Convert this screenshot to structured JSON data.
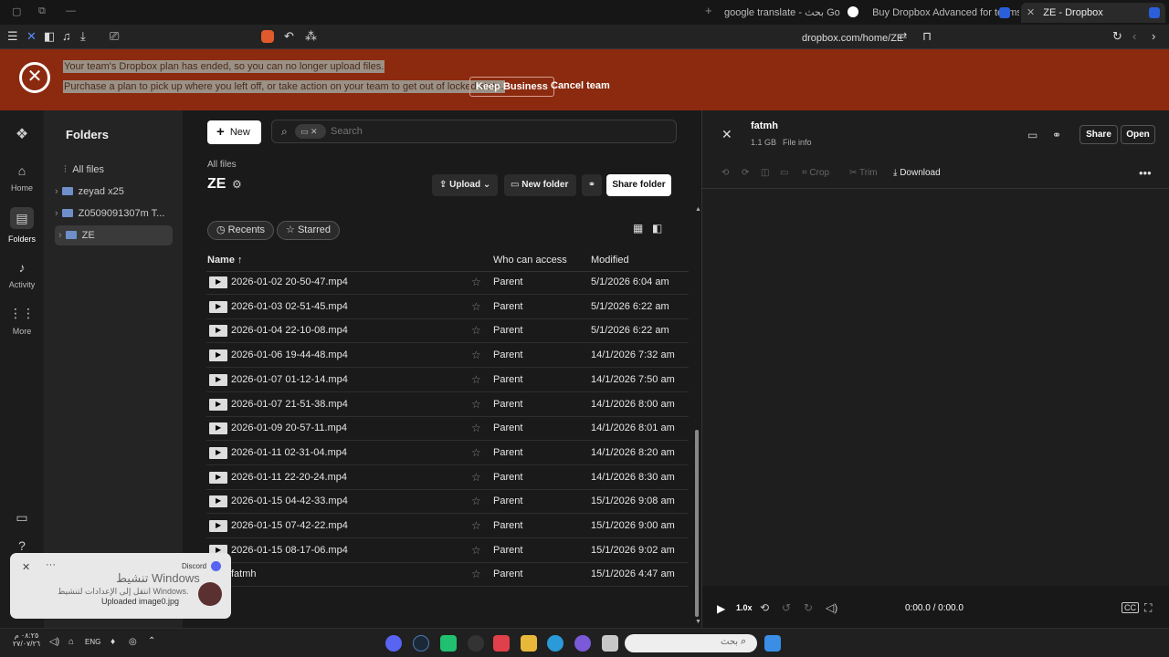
{
  "browser": {
    "tabs": [
      {
        "label": "google translate - بحث Google"
      },
      {
        "label": "Buy Dropbox Advanced for teams – D"
      },
      {
        "label": "ZE - Dropbox"
      }
    ],
    "address": "dropbox.com/home/ZE"
  },
  "banner": {
    "line1": "Your team's Dropbox plan has ended, so you can no longer upload files.",
    "line2": "Purchase a plan to pick up where you left off, or take action on your team to get out of locked state.",
    "keep_label": "Keep Business",
    "cancel_label": "Cancel team"
  },
  "rail": {
    "items": [
      {
        "label": "Home"
      },
      {
        "label": "Folders"
      },
      {
        "label": "Activity"
      },
      {
        "label": "More"
      }
    ]
  },
  "folders_panel": {
    "title": "Folders",
    "all_files": "All files",
    "items": [
      {
        "label": "zeyad x25"
      },
      {
        "label": "Z0509091307m T..."
      },
      {
        "label": "ZE"
      }
    ]
  },
  "main": {
    "new_label": "New",
    "search_placeholder": "Search",
    "breadcrumb": "All files",
    "folder_title": "ZE",
    "upload_label": "Upload",
    "new_folder_label": "New folder",
    "share_folder_label": "Share folder",
    "recents_label": "Recents",
    "starred_label": "Starred",
    "columns": {
      "name": "Name",
      "access": "Who can access",
      "modified": "Modified"
    },
    "files": [
      {
        "name": "2026-01-02 20-50-47.mp4",
        "access": "Parent",
        "modified": "5/1/2026 6:04 am"
      },
      {
        "name": "2026-01-03 02-51-45.mp4",
        "access": "Parent",
        "modified": "5/1/2026 6:22 am"
      },
      {
        "name": "2026-01-04 22-10-08.mp4",
        "access": "Parent",
        "modified": "5/1/2026 6:22 am"
      },
      {
        "name": "2026-01-06 19-44-48.mp4",
        "access": "Parent",
        "modified": "14/1/2026 7:32 am"
      },
      {
        "name": "2026-01-07 01-12-14.mp4",
        "access": "Parent",
        "modified": "14/1/2026 7:50 am"
      },
      {
        "name": "2026-01-07 21-51-38.mp4",
        "access": "Parent",
        "modified": "14/1/2026 8:00 am"
      },
      {
        "name": "2026-01-09 20-57-11.mp4",
        "access": "Parent",
        "modified": "14/1/2026 8:01 am"
      },
      {
        "name": "2026-01-11 02-31-04.mp4",
        "access": "Parent",
        "modified": "14/1/2026 8:20 am"
      },
      {
        "name": "2026-01-11 22-20-24.mp4",
        "access": "Parent",
        "modified": "14/1/2026 8:30 am"
      },
      {
        "name": "2026-01-15 04-42-33.mp4",
        "access": "Parent",
        "modified": "15/1/2026 9:08 am"
      },
      {
        "name": "2026-01-15 07-42-22.mp4",
        "access": "Parent",
        "modified": "15/1/2026 9:00 am"
      },
      {
        "name": "2026-01-15 08-17-06.mp4",
        "access": "Parent",
        "modified": "15/1/2026 9:02 am"
      },
      {
        "name": "fatmh",
        "access": "Parent",
        "modified": "15/1/2026 4:47 am"
      }
    ]
  },
  "preview": {
    "file_name": "fatmh",
    "size": "1.1 GB",
    "file_info": "File info",
    "share_label": "Share",
    "open_label": "Open",
    "crop_label": "Crop",
    "trim_label": "Trim",
    "download_label": "Download",
    "speed": "1.0x",
    "time": "0:00.0 / 0:00.0"
  },
  "toast": {
    "app": "Discord",
    "activate_title": "تنشيط Windows",
    "activate_sub": "انتقل إلى الإعدادات لتنشيط Windows.",
    "uploaded": "Uploaded image0.jpg"
  },
  "taskbar": {
    "clock_time": "٠٨:٢٥ م",
    "clock_date": "٢٧/٠٧/٢٦",
    "lang": "ENG",
    "search_placeholder": "بحث"
  },
  "colors": {
    "banner": "#8b2a0f",
    "accent_folder": "#6e8fc9",
    "dropbox_blue": "#0061fe"
  }
}
